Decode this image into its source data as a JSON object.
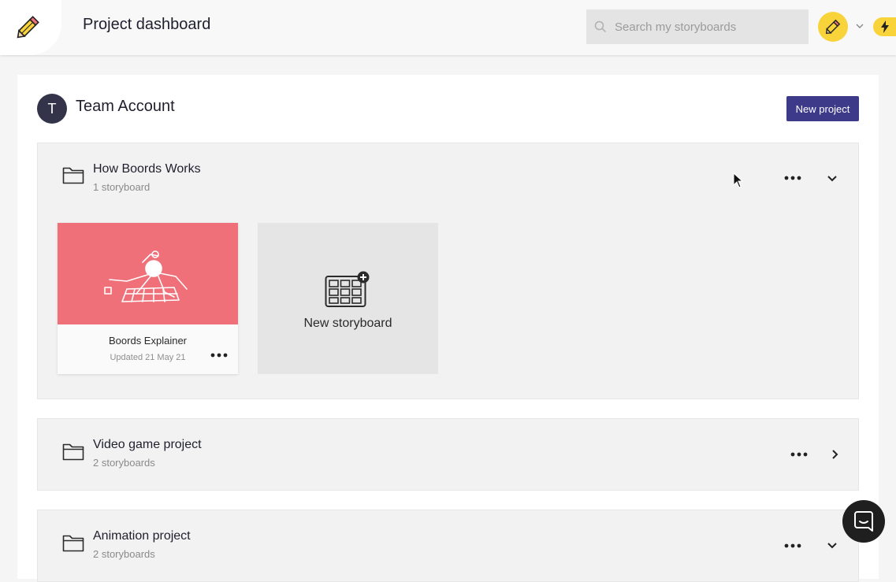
{
  "header": {
    "title": "Project dashboard",
    "search_placeholder": "Search my storyboards",
    "logo_icon": "pencil-icon",
    "avatar_icon": "pencil-icon",
    "bolt_icon": "bolt-icon"
  },
  "team": {
    "initial": "T",
    "name": "Team Account",
    "new_project_label": "New project"
  },
  "projects": [
    {
      "name": "How Boords Works",
      "count": "1 storyboard",
      "expanded": true,
      "storyboards": [
        {
          "title": "Boords Explainer",
          "updated": "Updated 21 May 21"
        }
      ],
      "new_storyboard_label": "New storyboard"
    },
    {
      "name": "Video game project",
      "count": "2 storyboards",
      "expanded": false
    },
    {
      "name": "Animation project",
      "count": "2 storyboards",
      "expanded": true
    }
  ],
  "colors": {
    "accent": "#3e3a8a",
    "avatar_yellow": "#f9d33a",
    "thumb_pink": "#ef7079",
    "team_avatar": "#333449"
  }
}
